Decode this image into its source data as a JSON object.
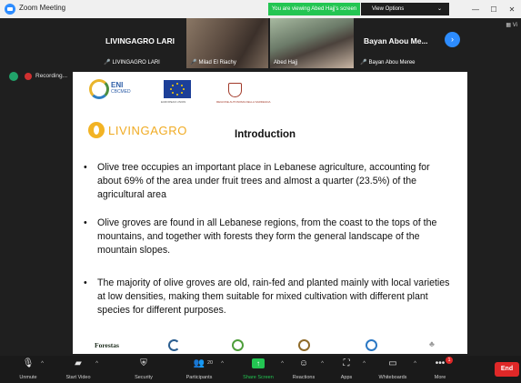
{
  "window": {
    "title": "Zoom Meeting",
    "controls": [
      "—",
      "☐",
      "✕"
    ]
  },
  "share_banner": {
    "status": "You are viewing Abed Hajj's screen",
    "view_options": "View Options"
  },
  "participants_strip": {
    "tiles": [
      {
        "name": "LIVINGAGRO LARI",
        "label": "LIVINGAGRO LARI"
      },
      {
        "name": "",
        "label": "Milad El Riachy"
      },
      {
        "name": "",
        "label": "Abed Hajj"
      },
      {
        "name": "Bayan Abou Me...",
        "label": "Bayan Abou Meree"
      }
    ],
    "side_label": "Vi"
  },
  "recording": {
    "label": "Recording...",
    "controls": "❚❚ ■"
  },
  "slide": {
    "eni_title": "ENI",
    "eni_subtitle": "CBCMED",
    "eu_caption": "EUROPEAN UNION",
    "crest_caption": "REGIONE AUTONOMA DELLA SARDEGNA",
    "project_name": "LIVINGAGRO",
    "title": "Introduction",
    "bullets": [
      "Olive tree occupies an important place in Lebanese agriculture, accounting for about 69% of the area under fruit trees and almost a quarter (23.5%) of the agricultural area",
      "Olive groves are found in all Lebanese regions, from the coast to the tops of the mountains, and together with forests they form the general landscape of the mountain slopes.",
      "The majority of olive groves are old, rain-fed and planted mainly with local varieties at low densities, making them suitable for mixed cultivation with different plant species for different purposes."
    ],
    "bullet_marker": "•",
    "footer_logo_text": "Forestas"
  },
  "toolbar": {
    "unmute": "Unmute",
    "start_video": "Start Video",
    "security": "Security",
    "participants": "Participants",
    "participants_count": "20",
    "share_screen": "Share Screen",
    "reactions": "Reactions",
    "apps": "Apps",
    "whiteboards": "Whiteboards",
    "more": "More",
    "more_badge": "1",
    "end": "End"
  },
  "colors": {
    "zoom_blue": "#2d8cff",
    "share_green": "#23c552",
    "end_red": "#e02828",
    "livingagro_orange": "#f0ab23"
  }
}
